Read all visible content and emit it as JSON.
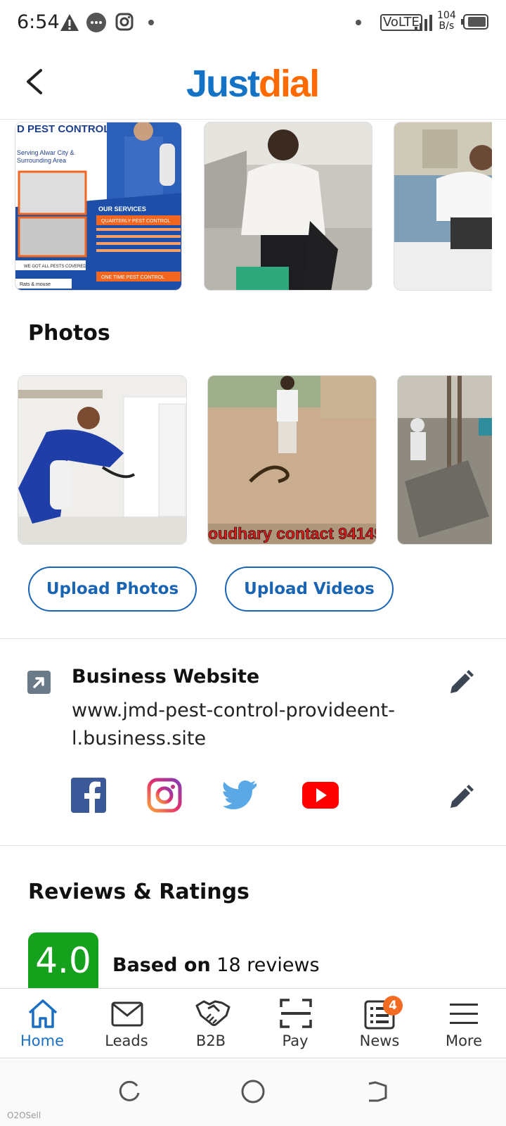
{
  "status_bar": {
    "time": "6:54",
    "network": "VoLTE",
    "speed_value": "104",
    "speed_unit": "B/s"
  },
  "header": {
    "logo_part1": "Just",
    "logo_part2": "dial",
    "brand_blue": "#1573c6",
    "brand_orange": "#ff6a00"
  },
  "sections": {
    "photos_title": "Photos",
    "upload_photos": "Upload Photos",
    "upload_videos": "Upload Videos"
  },
  "top_gallery": {
    "flyer_title": "D PEST CONTROL",
    "flyer_sub1": "Serving Alwar City &",
    "flyer_sub2": "Surrounding Area",
    "flyer_services": "OUR SERVICES",
    "flyer_tag": "QUARTERLY PEST CONTROL",
    "flyer_footer1": "WE GOT ALL PESTS COVERED",
    "flyer_footer2": "ONE TIME PEST CONTROL",
    "flyer_footer3": "Rats & mouse"
  },
  "photo_gallery": {
    "caption": "oudhary contact 94149"
  },
  "website": {
    "title": "Business Website",
    "url_line1": "www.jmd-pest-control-provideent-",
    "url_line2": "l.business.site"
  },
  "social": [
    "facebook",
    "instagram",
    "twitter",
    "youtube"
  ],
  "reviews": {
    "title": "Reviews & Ratings",
    "rating": "4.0",
    "based_on": "Based on",
    "count_text": "18 reviews",
    "rating_color": "#16a11c"
  },
  "bottom_nav": {
    "items": [
      {
        "label": "Home",
        "icon": "home-icon"
      },
      {
        "label": "Leads",
        "icon": "mail-icon"
      },
      {
        "label": "B2B",
        "icon": "handshake-icon"
      },
      {
        "label": "Pay",
        "icon": "scan-icon"
      },
      {
        "label": "News",
        "icon": "news-icon"
      },
      {
        "label": "More",
        "icon": "menu-icon"
      }
    ],
    "news_badge": "4",
    "active_color": "#1a6fc4"
  },
  "watermark": "O2OSell"
}
